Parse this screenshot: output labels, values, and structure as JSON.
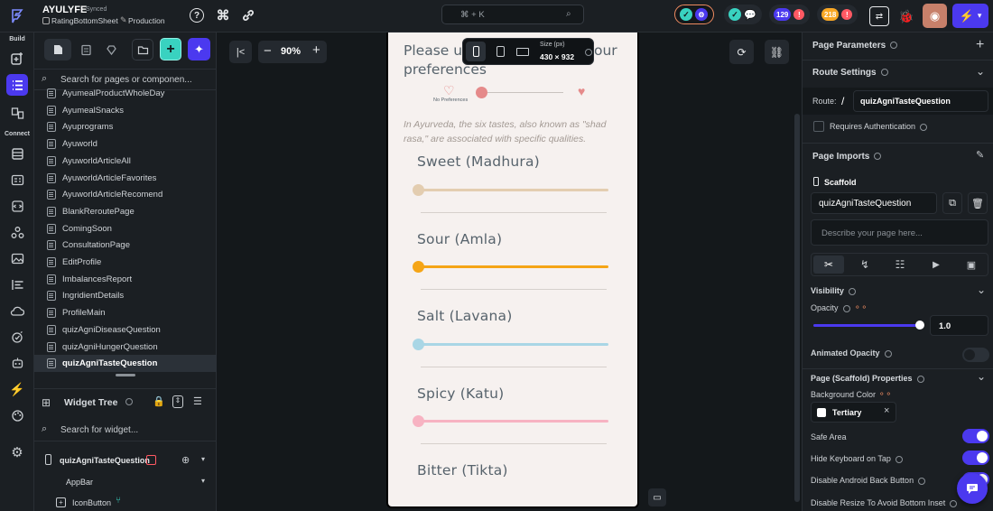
{
  "app": {
    "project_name": "AYULYFE",
    "sync_status": "Synced",
    "breadcrumb": "RatingBottomSheet",
    "environment": "Production",
    "search_shortcut": "⌘ + K",
    "badge_count_1": "129",
    "badge_count_2": "218"
  },
  "leftrail": {
    "build_label": "Build",
    "connect_label": "Connect"
  },
  "pages_panel": {
    "search_placeholder": "Search for pages or componen...",
    "pages": [
      "AyumealProductWholeDay",
      "AyumealSnacks",
      "Ayuprograms",
      "Ayuworld",
      "AyuworldArticleAll",
      "AyuworldArticleFavorites",
      "AyuworldArticleRecomend",
      "BlankReroutePage",
      "ComingSoon",
      "ConsultationPage",
      "EditProfile",
      "ImbalancesReport",
      "IngridientDetails",
      "ProfileMain",
      "quizAgniDiseaseQuestion",
      "quizAgniHungerQuestion",
      "quizAgniTasteQuestion"
    ],
    "selected_page": "quizAgniTasteQuestion"
  },
  "widget_tree": {
    "title": "Widget Tree",
    "search_placeholder": "Search for widget...",
    "root": "quizAgniTasteQuestion",
    "appbar": "AppBar",
    "icon_button": "IconButton"
  },
  "canvas": {
    "zoom": "90%",
    "size_label": "Size (px)",
    "size_value": "430 × 932"
  },
  "phone": {
    "heading_left": "Please u",
    "heading_right": "our",
    "heading_line2": "preferences",
    "no_preferences": "No Preferences",
    "description": "In Ayurveda, the six tastes, also known as \"shad rasa,\" are associated with specific qualities.",
    "tastes": [
      {
        "label": "Sweet (Madhura)",
        "color": "#e3cdb0"
      },
      {
        "label": "Sour (Amla)",
        "color": "#f5a516"
      },
      {
        "label": "Salt (Lavana)",
        "color": "#a9d6e5"
      },
      {
        "label": "Spicy (Katu)",
        "color": "#f7b3c2"
      },
      {
        "label": "Bitter (Tikta)",
        "color": ""
      }
    ]
  },
  "properties": {
    "page_parameters": "Page Parameters",
    "route_settings": "Route Settings",
    "route_label": "Route:",
    "route_slash": "/",
    "route_value": "quizAgniTasteQuestion",
    "requires_auth": "Requires Authentication",
    "page_imports": "Page Imports",
    "scaffold": "Scaffold",
    "page_name": "quizAgniTasteQuestion",
    "describe_placeholder": "Describe your page here...",
    "visibility": "Visibility",
    "opacity_label": "Opacity",
    "opacity_value": "1.0",
    "animated_opacity": "Animated Opacity",
    "scaffold_props": "Page (Scaffold) Properties",
    "background_color": "Background Color",
    "color_value": "Tertiary",
    "safe_area": "Safe Area",
    "hide_keyboard": "Hide Keyboard on Tap",
    "disable_back": "Disable Android Back Button",
    "disable_resize": "Disable Resize To Avoid Bottom Inset"
  },
  "colors": {
    "accent": "#4b39ef",
    "brand_green": "#39d2c0",
    "panel": "#1b1f23"
  }
}
